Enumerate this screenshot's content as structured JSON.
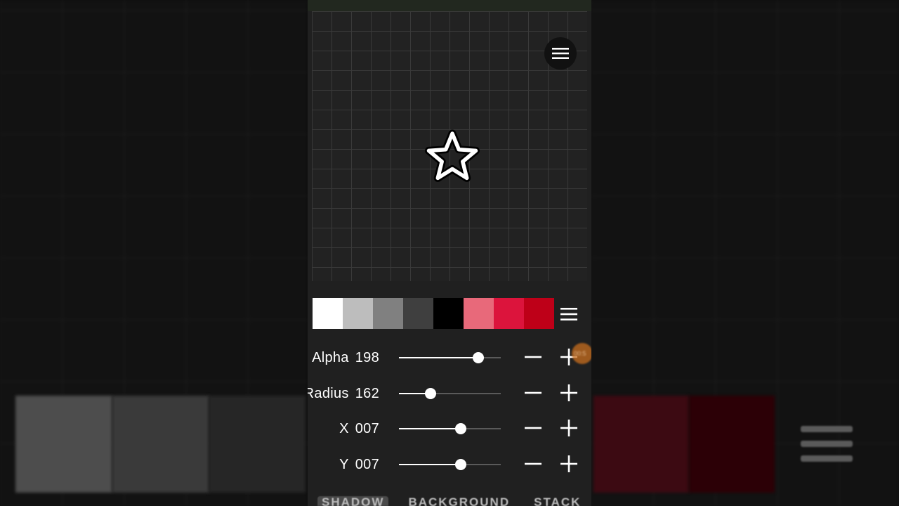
{
  "colors": {
    "app_bg": "#202020",
    "accent_thumb": "#ffffff",
    "palette": [
      "#ffffff",
      "#bdbdbd",
      "#808080",
      "#3f3f3f",
      "#000000",
      "#e8697a",
      "#dc143c",
      "#be0018"
    ],
    "bg_swatches": [
      "#4d4d4d",
      "#3a3a3a",
      "#262626",
      "#3c0a12",
      "#2c0006"
    ]
  },
  "icons": {
    "canvas_menu": "hamburger-menu-icon",
    "preview": "star-outline-icon",
    "palette_menu": "hamburger-menu-icon",
    "decrement": "minus-icon",
    "increment": "plus-icon"
  },
  "sliders": [
    {
      "id": "alpha",
      "label": "Alpha",
      "value": "198",
      "fraction": 0.776
    },
    {
      "id": "radius",
      "label": "Radius",
      "value": "162",
      "fraction": 0.31
    },
    {
      "id": "x",
      "label": "X",
      "value": "007",
      "fraction": 0.607
    },
    {
      "id": "y",
      "label": "Y",
      "value": "007",
      "fraction": 0.607
    }
  ],
  "recording_badge": "00:5",
  "tabs": [
    "SHADOW",
    "BACKGROUND",
    "STACK"
  ]
}
